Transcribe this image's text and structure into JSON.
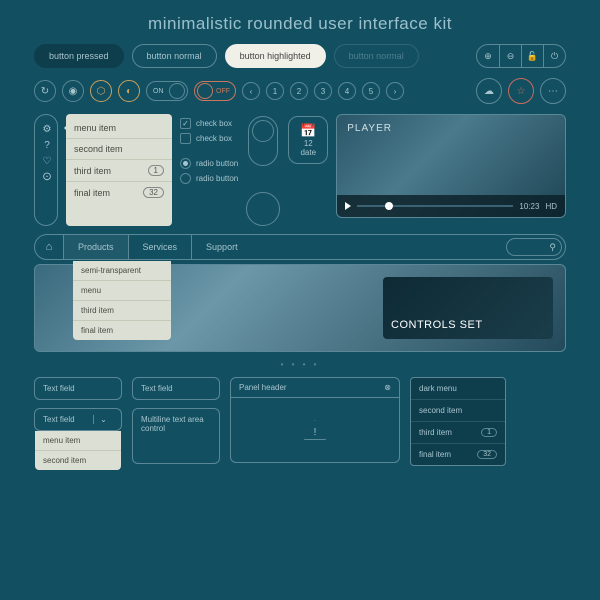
{
  "title": "minimalistic rounded user interface kit",
  "buttons": {
    "pressed": "button pressed",
    "normal": "button normal",
    "highlighted": "button highlighted",
    "normal2": "button normal"
  },
  "toggles": {
    "on": "ON",
    "off": "OFF"
  },
  "pager": {
    "numbers": [
      "1",
      "2",
      "3",
      "4",
      "5"
    ]
  },
  "menu_light": [
    {
      "label": "menu item"
    },
    {
      "label": "second item"
    },
    {
      "label": "third item",
      "badge": "1"
    },
    {
      "label": "final item",
      "badge": "32"
    }
  ],
  "checks": {
    "c1": "check box",
    "c2": "check box"
  },
  "radios": {
    "r1": "radio button",
    "r2": "radio button"
  },
  "date": {
    "day": "12",
    "label": "date"
  },
  "player": {
    "title": "PLAYER",
    "time": "10:23",
    "hd": "HD"
  },
  "nav": {
    "items": [
      "Products",
      "Services",
      "Support"
    ]
  },
  "nav_drop": [
    "semi-transparent",
    "menu",
    "third item",
    "final item"
  ],
  "hero": {
    "card": "CONTROLS SET"
  },
  "textfields": {
    "t1": "Text field",
    "t2": "Text field",
    "t3": "Text field",
    "multi": "Multiline text area control"
  },
  "combo_drop": [
    "menu item",
    "second item"
  ],
  "panel": {
    "header": "Panel header"
  },
  "dark_menu": [
    {
      "label": "dark menu"
    },
    {
      "label": "second item"
    },
    {
      "label": "third item",
      "badge": "1"
    },
    {
      "label": "final item",
      "badge": "32"
    }
  ]
}
